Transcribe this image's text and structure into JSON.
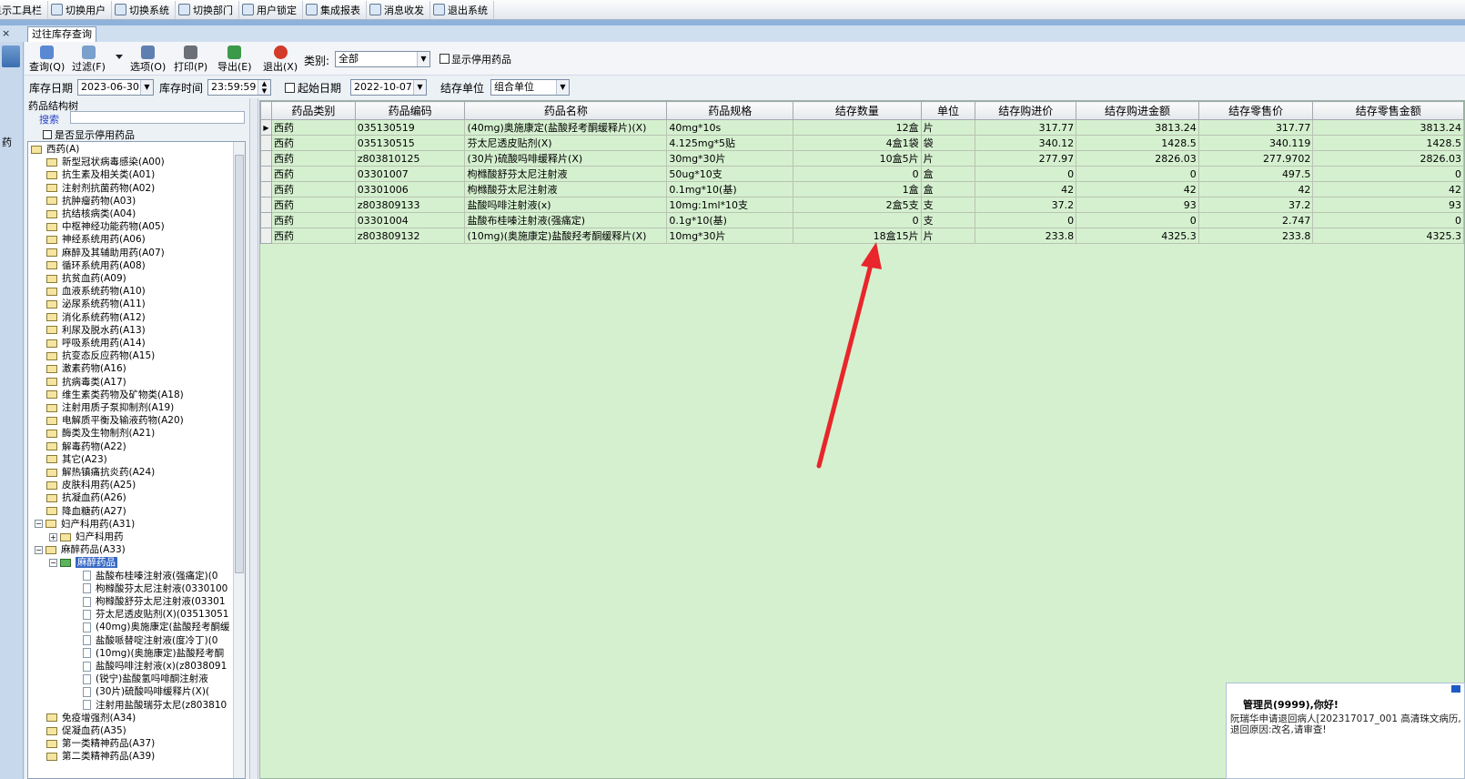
{
  "top_toolbar": {
    "items": [
      {
        "label": "显示工具栏",
        "icon": "toolbar-icon"
      },
      {
        "label": "切换用户",
        "icon": "user-switch-icon"
      },
      {
        "label": "切换系统",
        "icon": "system-switch-icon"
      },
      {
        "label": "切换部门",
        "icon": "department-switch-icon"
      },
      {
        "label": "用户锁定",
        "icon": "lock-icon"
      },
      {
        "label": "集成报表",
        "icon": "report-icon"
      },
      {
        "label": "消息收发",
        "icon": "info-icon"
      },
      {
        "label": "退出系统",
        "icon": "exit-icon"
      }
    ]
  },
  "tab": {
    "label": "过往库存查询",
    "close": "×"
  },
  "left_strip": {
    "text": "药"
  },
  "toolbar": {
    "buttons": [
      {
        "label": "查询(Q)",
        "icon": "refresh-icon"
      },
      {
        "label": "过滤(F)",
        "icon": "filter-icon"
      },
      {
        "label": "选项(O)",
        "icon": "options-icon"
      },
      {
        "label": "打印(P)",
        "icon": "printer-icon"
      },
      {
        "label": "导出(E)",
        "icon": "excel-export-icon"
      },
      {
        "label": "退出(X)",
        "icon": "power-icon"
      }
    ],
    "category_label": "类别:",
    "category_value": "全部",
    "show_disabled_label": "显示停用药品"
  },
  "filter": {
    "stock_date_label": "库存日期",
    "stock_date": "2023-06-30",
    "stock_time_label": "库存时间",
    "stock_time": "23:59:59",
    "start_date_label": "起始日期",
    "start_date": "2022-10-07",
    "unit_label": "结存单位",
    "unit_value": "组合单位"
  },
  "left_panel": {
    "title": "药品结构树",
    "search_label": "搜索",
    "show_disabled_label": "是否显示停用药品",
    "tree": [
      {
        "d": 0,
        "t": "西药(A)",
        "e": "−",
        "k": "folder"
      },
      {
        "d": 1,
        "t": "新型冠状病毒感染(A00)",
        "k": "folder"
      },
      {
        "d": 1,
        "t": "抗生素及相关类(A01)",
        "k": "folder"
      },
      {
        "d": 1,
        "t": "注射剂抗菌药物(A02)",
        "k": "folder"
      },
      {
        "d": 1,
        "t": "抗肿瘤药物(A03)",
        "k": "folder"
      },
      {
        "d": 1,
        "t": "抗结核病类(A04)",
        "k": "folder"
      },
      {
        "d": 1,
        "t": "中枢神经功能药物(A05)",
        "k": "folder"
      },
      {
        "d": 1,
        "t": "神经系统用药(A06)",
        "k": "folder"
      },
      {
        "d": 1,
        "t": "麻醉及其辅助用药(A07)",
        "k": "folder"
      },
      {
        "d": 1,
        "t": "循环系统用药(A08)",
        "k": "folder"
      },
      {
        "d": 1,
        "t": "抗贫血药(A09)",
        "k": "folder"
      },
      {
        "d": 1,
        "t": "血液系统药物(A10)",
        "k": "folder"
      },
      {
        "d": 1,
        "t": "泌尿系统药物(A11)",
        "k": "folder"
      },
      {
        "d": 1,
        "t": "消化系统药物(A12)",
        "k": "folder"
      },
      {
        "d": 1,
        "t": "利尿及脱水药(A13)",
        "k": "folder"
      },
      {
        "d": 1,
        "t": "呼吸系统用药(A14)",
        "k": "folder"
      },
      {
        "d": 1,
        "t": "抗变态反应药物(A15)",
        "k": "folder"
      },
      {
        "d": 1,
        "t": "激素药物(A16)",
        "k": "folder"
      },
      {
        "d": 1,
        "t": "抗病毒类(A17)",
        "k": "folder"
      },
      {
        "d": 1,
        "t": "维生素类药物及矿物类(A18)",
        "k": "folder"
      },
      {
        "d": 1,
        "t": "注射用质子泵抑制剂(A19)",
        "k": "folder"
      },
      {
        "d": 1,
        "t": "电解质平衡及输液药物(A20)",
        "k": "folder"
      },
      {
        "d": 1,
        "t": "酶类及生物制剂(A21)",
        "k": "folder"
      },
      {
        "d": 1,
        "t": "解毒药物(A22)",
        "k": "folder"
      },
      {
        "d": 1,
        "t": "其它(A23)",
        "k": "folder"
      },
      {
        "d": 1,
        "t": "解热镇痛抗炎药(A24)",
        "k": "folder"
      },
      {
        "d": 1,
        "t": "皮肤科用药(A25)",
        "k": "folder"
      },
      {
        "d": 1,
        "t": "抗凝血药(A26)",
        "k": "folder"
      },
      {
        "d": 1,
        "t": "降血糖药(A27)",
        "k": "folder"
      },
      {
        "d": 1,
        "t": "妇产科用药(A31)",
        "e": "−",
        "k": "folder"
      },
      {
        "d": 2,
        "t": "妇产科用药",
        "e": "+",
        "k": "folder"
      },
      {
        "d": 1,
        "t": "麻醉药品(A33)",
        "e": "−",
        "k": "folder"
      },
      {
        "d": 2,
        "t": "麻醉药品",
        "e": "−",
        "k": "folder",
        "sel": true
      },
      {
        "d": 3,
        "t": "盐酸布桂嗪注射液(强痛定)(0",
        "k": "doc"
      },
      {
        "d": 3,
        "t": "枸橼酸芬太尼注射液(0330100",
        "k": "doc"
      },
      {
        "d": 3,
        "t": "枸橼酸舒芬太尼注射液(03301",
        "k": "doc"
      },
      {
        "d": 3,
        "t": "芬太尼透皮贴剂(X)(03513051",
        "k": "doc"
      },
      {
        "d": 3,
        "t": "(40mg)奥施康定(盐酸羟考酮缓",
        "k": "doc"
      },
      {
        "d": 3,
        "t": "盐酸哌替啶注射液(度冷丁)(0",
        "k": "doc"
      },
      {
        "d": 3,
        "t": "(10mg)(奥施康定)盐酸羟考酮",
        "k": "doc"
      },
      {
        "d": 3,
        "t": "盐酸吗啡注射液(x)(z8038091",
        "k": "doc"
      },
      {
        "d": 3,
        "t": "(锐宁)盐酸氢吗啡酮注射液",
        "k": "doc"
      },
      {
        "d": 3,
        "t": "(30片)硫酸吗啡缓释片(X)(",
        "k": "doc"
      },
      {
        "d": 3,
        "t": "注射用盐酸瑞芬太尼(z803810",
        "k": "doc"
      },
      {
        "d": 1,
        "t": "免疫增强剂(A34)",
        "k": "folder"
      },
      {
        "d": 1,
        "t": "促凝血药(A35)",
        "k": "folder"
      },
      {
        "d": 1,
        "t": "第一类精神药品(A37)",
        "k": "folder"
      },
      {
        "d": 1,
        "t": "第二类精神药品(A39)",
        "k": "folder"
      }
    ]
  },
  "grid": {
    "columns": [
      "药品类别",
      "药品编码",
      "药品名称",
      "药品规格",
      "结存数量",
      "单位",
      "结存购进价",
      "结存购进金额",
      "结存零售价",
      "结存零售金额"
    ],
    "rows": [
      [
        "西药",
        "035130519",
        "(40mg)奥施康定(盐酸羟考酮缓释片)(X)",
        "40mg*10s",
        "12盒",
        "片",
        "317.77",
        "3813.24",
        "317.77",
        "3813.24"
      ],
      [
        "西药",
        "035130515",
        "芬太尼透皮贴剂(X)",
        "4.125mg*5贴",
        "4盒1袋",
        "袋",
        "340.12",
        "1428.5",
        "340.119",
        "1428.5"
      ],
      [
        "西药",
        "z803810125",
        "(30片)硫酸吗啡缓释片(X)",
        "30mg*30片",
        "10盒5片",
        "片",
        "277.97",
        "2826.03",
        "277.9702",
        "2826.03"
      ],
      [
        "西药",
        "03301007",
        "枸橼酸舒芬太尼注射液",
        "50ug*10支",
        "0",
        "盒",
        "0",
        "0",
        "497.5",
        "0"
      ],
      [
        "西药",
        "03301006",
        "枸橼酸芬太尼注射液",
        "0.1mg*10(基)",
        "1盒",
        "盒",
        "42",
        "42",
        "42",
        "42"
      ],
      [
        "西药",
        "z803809133",
        "盐酸吗啡注射液(x)",
        "10mg:1ml*10支",
        "2盒5支",
        "支",
        "37.2",
        "93",
        "37.2",
        "93"
      ],
      [
        "西药",
        "03301004",
        "盐酸布桂嗪注射液(强痛定)",
        "0.1g*10(基)",
        "0",
        "支",
        "0",
        "0",
        "2.747",
        "0"
      ],
      [
        "西药",
        "z803809132",
        "(10mg)(奥施康定)盐酸羟考酮缓释片(X)",
        "10mg*30片",
        "18盒15片",
        "片",
        "233.8",
        "4325.3",
        "233.8",
        "4325.3"
      ]
    ]
  },
  "notification": {
    "title": "管理员(9999),你好!",
    "body": "阮瑞华申请退回病人[202317017_001 高清珠文病历,退回原因:改名,请审查!"
  },
  "colors": {
    "grid_bg": "#d5f0cf",
    "arrow": "#e8262b",
    "selection": "#3768c5"
  }
}
